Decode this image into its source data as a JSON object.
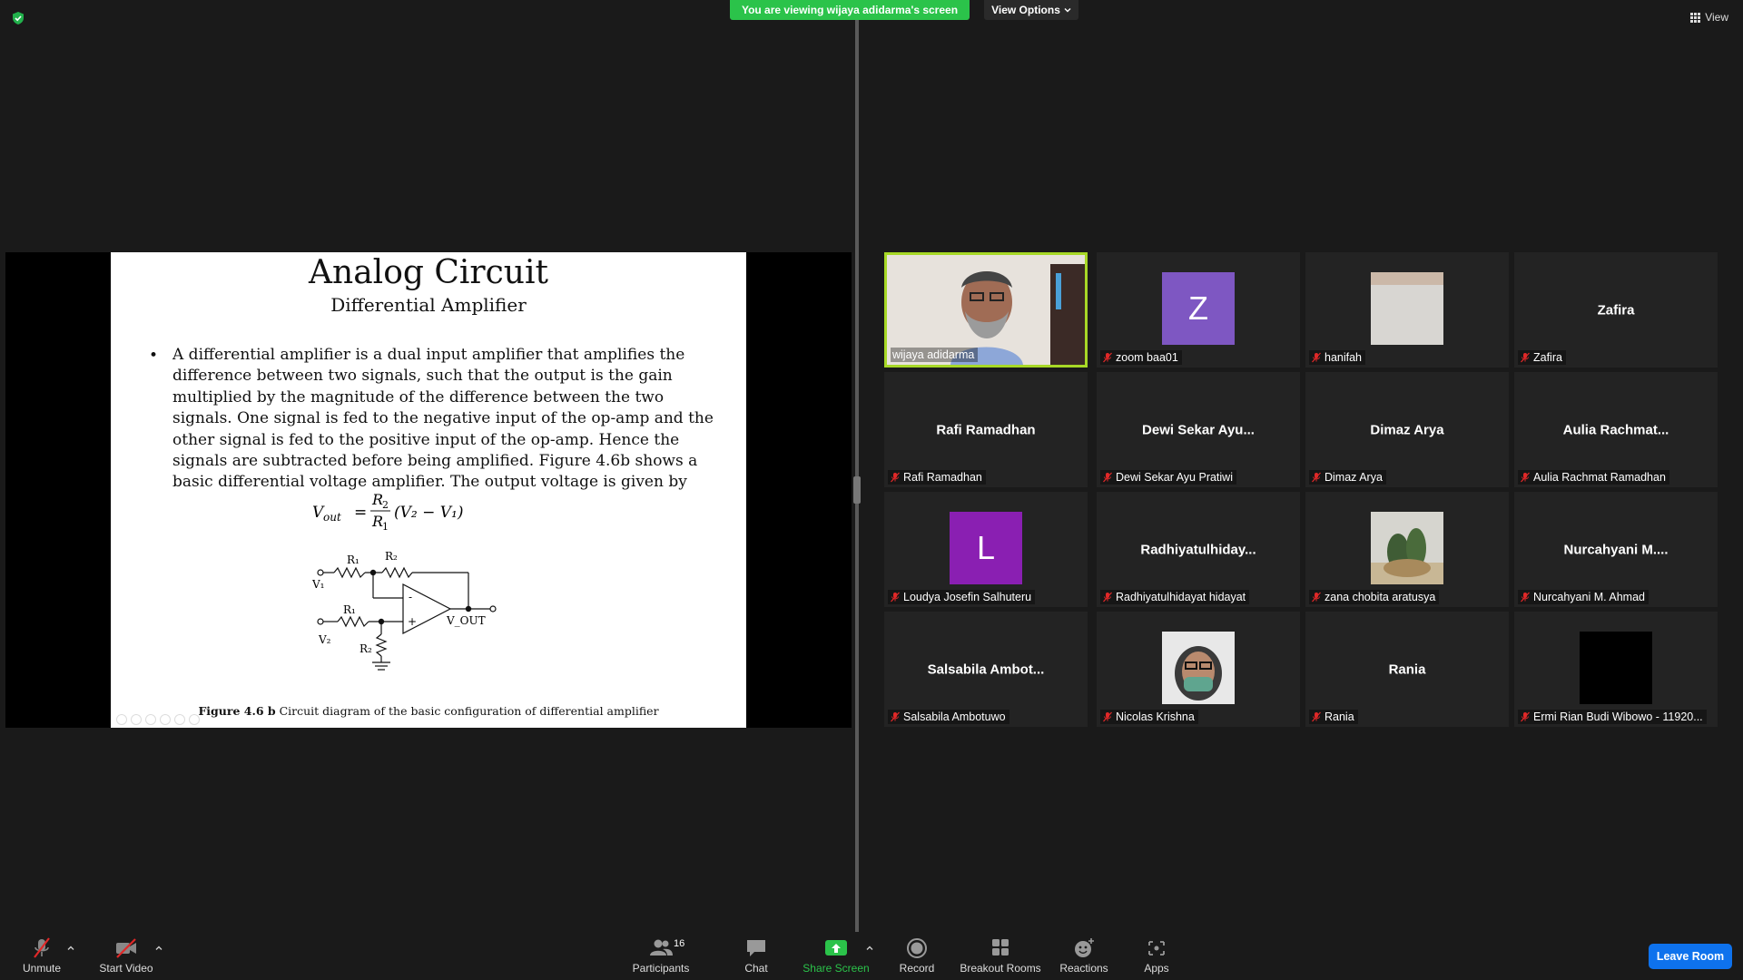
{
  "banner": {
    "viewing_text": "You are viewing wijaya adidarma's screen",
    "view_options": "View Options"
  },
  "top_right": {
    "view_label": "View"
  },
  "slide": {
    "title": "Analog Circuit",
    "subtitle": "Differential Amplifier",
    "bullet": "•",
    "body": "A differential amplifier is a dual input amplifier that amplifies the difference between two signals, such that the output is the gain multiplied by the magnitude of the difference between the two signals. One signal is fed to the negative input of the op-amp and the other signal is fed to the positive input of the op-amp. Hence the signals are subtracted before being amplified. Figure 4.6b shows a basic differential voltage amplifier. The output voltage is given by",
    "formula": {
      "lhs": "V",
      "lhs_sub": "out",
      "equals": "=",
      "numerator": "R",
      "numerator_sub": "2",
      "denominator": "R",
      "denominator_sub": "1",
      "rhs": "(V₂ − V₁)"
    },
    "circuit_labels": {
      "r1_top": "R₁",
      "r2_top": "R₂",
      "v1": "V₁",
      "r1_bottom": "R₁",
      "v2": "V₂",
      "r2_bottom": "R₂",
      "minus": "-",
      "plus": "+",
      "vout": "V_OUT"
    },
    "caption_bold": "Figure 4.6 b",
    "caption_rest": " Circuit diagram of the basic configuration of  differential amplifier"
  },
  "participants": [
    {
      "name": "wijaya adidarma",
      "center": "",
      "kind": "video",
      "active": true
    },
    {
      "name": "zoom baa01",
      "center": "Z",
      "kind": "letter",
      "color": "#7e57c2"
    },
    {
      "name": "hanifah",
      "center": "",
      "kind": "image"
    },
    {
      "name": "Zafira",
      "center": "Zafira",
      "kind": "name"
    },
    {
      "name": "Rafi Ramadhan",
      "center": "Rafi Ramadhan",
      "kind": "name"
    },
    {
      "name": "Dewi Sekar Ayu Pratiwi",
      "center": "Dewi Sekar Ayu...",
      "kind": "name"
    },
    {
      "name": "Dimaz Arya",
      "center": "Dimaz Arya",
      "kind": "name"
    },
    {
      "name": "Aulia Rachmat Ramadhan",
      "center": "Aulia  Rachmat...",
      "kind": "name"
    },
    {
      "name": "Loudya Josefin Salhuteru",
      "center": "L",
      "kind": "letter",
      "color": "#8a1fb2"
    },
    {
      "name": "Radhiyatulhidayat hidayat",
      "center": "Radhiyatulhiday...",
      "kind": "name"
    },
    {
      "name": "zana chobita aratusya",
      "center": "",
      "kind": "image"
    },
    {
      "name": "Nurcahyani M. Ahmad",
      "center": "Nurcahyani  M....",
      "kind": "name"
    },
    {
      "name": "Salsabila Ambotuwo",
      "center": "Salsabila  Ambot...",
      "kind": "name"
    },
    {
      "name": "Nicolas Krishna",
      "center": "",
      "kind": "image"
    },
    {
      "name": "Rania",
      "center": "Rania",
      "kind": "name"
    },
    {
      "name": "Ermi Rian Budi Wibowo - 11920...",
      "center": "",
      "kind": "black"
    }
  ],
  "toolbar": {
    "unmute": "Unmute",
    "start_video": "Start Video",
    "participants": "Participants",
    "participants_count": "16",
    "chat": "Chat",
    "share_screen": "Share Screen",
    "record": "Record",
    "breakout_rooms": "Breakout Rooms",
    "reactions": "Reactions",
    "apps": "Apps",
    "leave": "Leave Room"
  },
  "colors": {
    "accent_green": "#2bc34a",
    "active_border": "#a7d826",
    "leave_blue": "#0e72ed",
    "mute_red": "#e02828"
  }
}
